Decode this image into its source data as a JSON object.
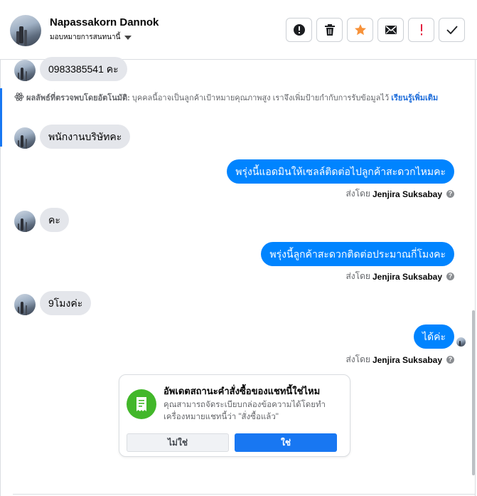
{
  "header": {
    "name": "Napassakorn Dannok",
    "subtitle": "มอบหมายการสนทนานี้",
    "actions": [
      {
        "name": "report-button",
        "icon": "alert-circle-icon"
      },
      {
        "name": "delete-button",
        "icon": "trash-icon"
      },
      {
        "name": "star-button",
        "icon": "star-icon"
      },
      {
        "name": "mark-unread-button",
        "icon": "envelope-icon"
      },
      {
        "name": "follow-up-button",
        "icon": "exclamation-icon"
      },
      {
        "name": "done-button",
        "icon": "check-icon"
      }
    ]
  },
  "messages": {
    "m1": "0983385541 คะ",
    "auto_label": "ผลลัพธ์ที่ตรวจพบโดยอัตโนมัติ:",
    "auto_text": " บุคคลนี้อาจเป็นลูกค้าเป้าหมายคุณภาพสูง เราจึงเพิ่มป้ายกำกับการรับข้อมูลไว้ ",
    "auto_link": "เรียนรู้เพิ่มเติม",
    "m2": "พนักงานบริษัทคะ",
    "m3": "พรุ่งนี้แอดมินให้เซลล์ติดต่อไปลูกค้าสะดวกไหมคะ",
    "m4": "คะ",
    "m5": "พรุ่งนี้ลูกค้าสะดวกติดต่อประมาณกี่โมงคะ",
    "m6": "9โมงค่ะ",
    "m7": "ได้ค่ะ"
  },
  "sent_by": {
    "prefix": "ส่งโดย",
    "agent": "Jenjira Suksabay"
  },
  "card": {
    "title": "อัพเดตสถานะคำสั่งซื้อของแชทนี้ใช่ไหม",
    "desc": "คุณสามารถจัดระเบียบกล่องข้อความได้โดยทำเครื่องหมายแชทนี้ว่า \"สั่งซื้อแล้ว\"",
    "no_label": "ไม่ใช่",
    "yes_label": "ใช่",
    "icon": "receipt-icon"
  },
  "colors": {
    "accent": "#1877f2",
    "bubble_out": "#0084ff",
    "bubble_in": "#e4e6eb",
    "star": "#f7923a",
    "followup": "#e41e3f",
    "success": "#42b72a"
  }
}
